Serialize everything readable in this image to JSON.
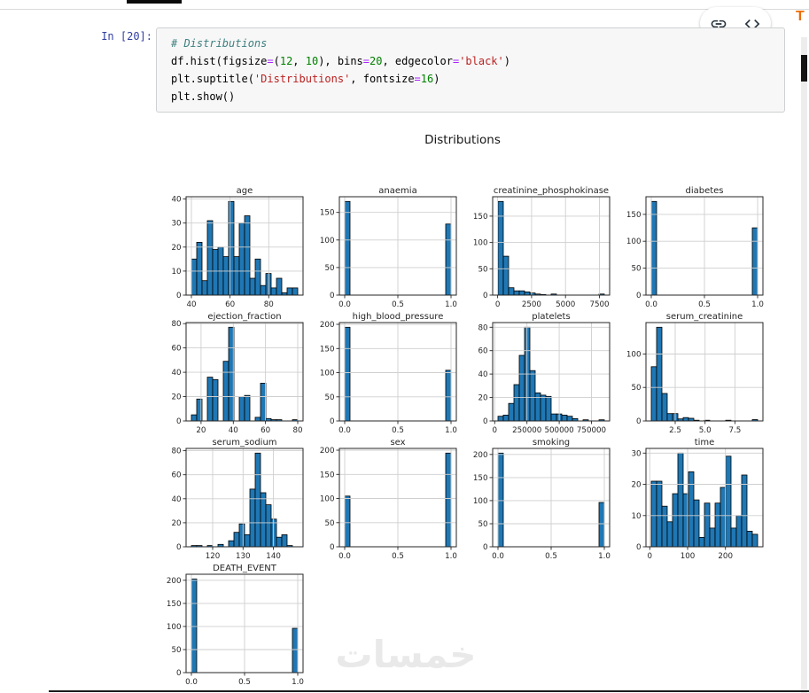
{
  "notebook": {
    "cell": {
      "prompt": "In [20]:",
      "code_lines": [
        [
          {
            "t": "# Distributions",
            "c": "com"
          }
        ],
        [
          {
            "t": "df.hist(figsize",
            "c": "n"
          },
          {
            "t": "=",
            "c": "op"
          },
          {
            "t": "(",
            "c": "n"
          },
          {
            "t": "12",
            "c": "num"
          },
          {
            "t": ", ",
            "c": "n"
          },
          {
            "t": "10",
            "c": "num"
          },
          {
            "t": "), bins",
            "c": "n"
          },
          {
            "t": "=",
            "c": "op"
          },
          {
            "t": "20",
            "c": "num"
          },
          {
            "t": ", edgecolor",
            "c": "n"
          },
          {
            "t": "=",
            "c": "op"
          },
          {
            "t": "'black'",
            "c": "str"
          },
          {
            "t": ")",
            "c": "n"
          }
        ],
        [
          {
            "t": "plt.suptitle(",
            "c": "n"
          },
          {
            "t": "'Distributions'",
            "c": "str"
          },
          {
            "t": ", fontsize",
            "c": "n"
          },
          {
            "t": "=",
            "c": "op"
          },
          {
            "t": "16",
            "c": "num"
          },
          {
            "t": ")",
            "c": "n"
          }
        ],
        [
          {
            "t": "plt.show()",
            "c": "n"
          }
        ]
      ]
    },
    "toolbar": {
      "buttons": [
        {
          "name": "link-button",
          "icon": "link-icon"
        },
        {
          "name": "view-code-button",
          "icon": "code-icon"
        }
      ]
    },
    "side_panel": {
      "truncated_text": "T",
      "color": "#ed6c02"
    }
  },
  "figure": {
    "suptitle": "Distributions",
    "watermark": "خمسات",
    "colors": {
      "bar_fill": "#1f77b4",
      "bar_edge": "#000000",
      "grid": "#cfcfcf",
      "spine": "#262626"
    }
  },
  "chart_data": [
    {
      "type": "histogram",
      "title": "age",
      "bins": 20,
      "xmin": 40,
      "xmax": 95,
      "xtick_vals": [
        40,
        60,
        80
      ],
      "xtick_labels": [
        "40",
        "60",
        "80"
      ],
      "yticks": [
        0,
        10,
        20,
        30,
        40
      ],
      "values": [
        15,
        22,
        6,
        31,
        19,
        20,
        16,
        39,
        16,
        30,
        33,
        7,
        15,
        4,
        9,
        3,
        7,
        1,
        3,
        3
      ]
    },
    {
      "type": "histogram",
      "title": "anaemia",
      "bins": 20,
      "xmin": 0,
      "xmax": 1,
      "xtick_vals": [
        0,
        0.5,
        1
      ],
      "xtick_labels": [
        "0.0",
        "0.5",
        "1.0"
      ],
      "yticks": [
        0,
        50,
        100,
        150
      ],
      "values": [
        170,
        0,
        0,
        0,
        0,
        0,
        0,
        0,
        0,
        0,
        0,
        0,
        0,
        0,
        0,
        0,
        0,
        0,
        0,
        129
      ]
    },
    {
      "type": "histogram",
      "title": "creatinine_phosphokinase",
      "bins": 20,
      "xmin": 23,
      "xmax": 7861,
      "xtick_vals": [
        0,
        2500,
        5000,
        7500
      ],
      "xtick_labels": [
        "0",
        "2500",
        "5000",
        "7500"
      ],
      "yticks": [
        0,
        50,
        100,
        150
      ],
      "values": [
        178,
        74,
        14,
        8,
        8,
        6,
        4,
        2,
        1,
        0,
        2,
        0,
        0,
        0,
        0,
        0,
        0,
        0,
        0,
        2
      ]
    },
    {
      "type": "histogram",
      "title": "diabetes",
      "bins": 20,
      "xmin": 0,
      "xmax": 1,
      "xtick_vals": [
        0,
        0.5,
        1
      ],
      "xtick_labels": [
        "0.0",
        "0.5",
        "1.0"
      ],
      "yticks": [
        0,
        50,
        100,
        150
      ],
      "values": [
        174,
        0,
        0,
        0,
        0,
        0,
        0,
        0,
        0,
        0,
        0,
        0,
        0,
        0,
        0,
        0,
        0,
        0,
        0,
        125
      ]
    },
    {
      "type": "histogram",
      "title": "ejection_fraction",
      "bins": 20,
      "xmin": 14,
      "xmax": 80,
      "xtick_vals": [
        20,
        40,
        60,
        80
      ],
      "xtick_labels": [
        "20",
        "40",
        "60",
        "80"
      ],
      "yticks": [
        0,
        20,
        40,
        60,
        80
      ],
      "values": [
        5,
        18,
        0,
        36,
        34,
        0,
        49,
        77,
        0,
        20,
        21,
        0,
        3,
        31,
        2,
        1,
        1,
        0,
        0,
        1
      ]
    },
    {
      "type": "histogram",
      "title": "high_blood_pressure",
      "bins": 20,
      "xmin": 0,
      "xmax": 1,
      "xtick_vals": [
        0,
        0.5,
        1
      ],
      "xtick_labels": [
        "0.0",
        "0.5",
        "1.0"
      ],
      "yticks": [
        0,
        50,
        100,
        150,
        200
      ],
      "values": [
        194,
        0,
        0,
        0,
        0,
        0,
        0,
        0,
        0,
        0,
        0,
        0,
        0,
        0,
        0,
        0,
        0,
        0,
        0,
        105
      ]
    },
    {
      "type": "histogram",
      "title": "platelets",
      "bins": 20,
      "xmin": 25100,
      "xmax": 850000,
      "xtick_vals": [
        0,
        250000,
        500000,
        750000
      ],
      "xtick_labels": [
        "0",
        "250000",
        "500000",
        "750000"
      ],
      "yticks": [
        0,
        20,
        40,
        60,
        80
      ],
      "values": [
        4,
        5,
        15,
        31,
        56,
        80,
        43,
        24,
        22,
        21,
        6,
        6,
        5,
        4,
        2,
        0,
        1,
        0,
        0,
        1
      ]
    },
    {
      "type": "histogram",
      "title": "serum_creatinine",
      "bins": 20,
      "xmin": 0.5,
      "xmax": 9.4,
      "xtick_vals": [
        2.5,
        5,
        7.5
      ],
      "xtick_labels": [
        "2.5",
        "5.0",
        "7.5"
      ],
      "yticks": [
        0,
        50,
        100
      ],
      "values": [
        81,
        140,
        41,
        11,
        11,
        3,
        5,
        4,
        1,
        0,
        1,
        0,
        0,
        0,
        1,
        0,
        0,
        0,
        0,
        2
      ]
    },
    {
      "type": "histogram",
      "title": "serum_sodium",
      "bins": 20,
      "xmin": 113,
      "xmax": 148,
      "xtick_vals": [
        120,
        130,
        140
      ],
      "xtick_labels": [
        "120",
        "130",
        "140"
      ],
      "yticks": [
        0,
        20,
        40,
        60,
        80
      ],
      "values": [
        1,
        1,
        0,
        1,
        0,
        2,
        0,
        5,
        12,
        19,
        10,
        48,
        78,
        45,
        35,
        23,
        8,
        10,
        1,
        0
      ]
    },
    {
      "type": "histogram",
      "title": "sex",
      "bins": 20,
      "xmin": 0,
      "xmax": 1,
      "xtick_vals": [
        0,
        0.5,
        1
      ],
      "xtick_labels": [
        "0.0",
        "0.5",
        "1.0"
      ],
      "yticks": [
        0,
        50,
        100,
        150,
        200
      ],
      "values": [
        105,
        0,
        0,
        0,
        0,
        0,
        0,
        0,
        0,
        0,
        0,
        0,
        0,
        0,
        0,
        0,
        0,
        0,
        0,
        194
      ]
    },
    {
      "type": "histogram",
      "title": "smoking",
      "bins": 20,
      "xmin": 0,
      "xmax": 1,
      "xtick_vals": [
        0,
        0.5,
        1
      ],
      "xtick_labels": [
        "0.0",
        "0.5",
        "1.0"
      ],
      "yticks": [
        0,
        50,
        100,
        150,
        200
      ],
      "values": [
        203,
        0,
        0,
        0,
        0,
        0,
        0,
        0,
        0,
        0,
        0,
        0,
        0,
        0,
        0,
        0,
        0,
        0,
        0,
        96
      ]
    },
    {
      "type": "histogram",
      "title": "time",
      "bins": 20,
      "xmin": 4,
      "xmax": 285,
      "xtick_vals": [
        0,
        100,
        200
      ],
      "xtick_labels": [
        "0",
        "100",
        "200"
      ],
      "yticks": [
        0,
        10,
        20,
        30
      ],
      "values": [
        21,
        21,
        13,
        8,
        17,
        30,
        17,
        24,
        15,
        3,
        14,
        6,
        14,
        19,
        29,
        6,
        10,
        23,
        5,
        4
      ]
    },
    {
      "type": "histogram",
      "title": "DEATH_EVENT",
      "bins": 20,
      "xmin": 0,
      "xmax": 1,
      "xtick_vals": [
        0,
        0.5,
        1
      ],
      "xtick_labels": [
        "0.0",
        "0.5",
        "1.0"
      ],
      "yticks": [
        0,
        50,
        100,
        150,
        200
      ],
      "values": [
        203,
        0,
        0,
        0,
        0,
        0,
        0,
        0,
        0,
        0,
        0,
        0,
        0,
        0,
        0,
        0,
        0,
        0,
        0,
        96
      ]
    }
  ]
}
